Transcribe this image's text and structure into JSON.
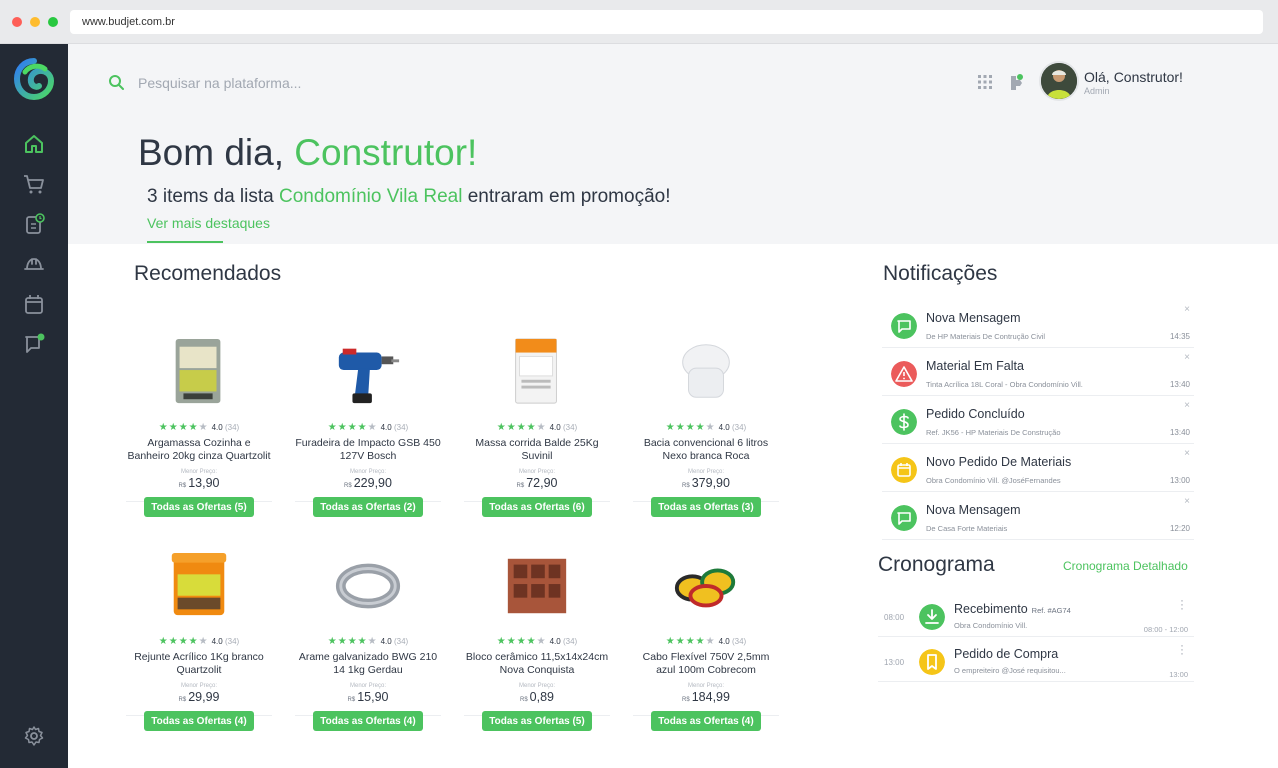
{
  "browser": {
    "url": "www.budjet.com.br"
  },
  "colors": {
    "accent": "#4cc35f",
    "sidebar": "#232a35",
    "warning": "#eb5b5b",
    "yellow": "#f5c518"
  },
  "sidebar": {
    "items": [
      {
        "icon": "home-icon"
      },
      {
        "icon": "cart-icon"
      },
      {
        "icon": "clipboard-clock-icon"
      },
      {
        "icon": "helmet-icon"
      },
      {
        "icon": "calendar-icon"
      },
      {
        "icon": "chat-icon"
      }
    ],
    "settings_icon": "gear-icon"
  },
  "header": {
    "search_placeholder": "Pesquisar na plataforma...",
    "greeting_prefix": "Olá,",
    "user_name": "Construtor!",
    "role": "Admin"
  },
  "hero": {
    "hello": "Bom dia,",
    "name": "Construtor!",
    "promo_prefix": "3 items da lista",
    "promo_list": "Condomínio Vila Real",
    "promo_suffix": "entraram em promoção!",
    "more_link": "Ver mais destaques"
  },
  "recommended": {
    "title": "Recomendados",
    "price_label": "Menor Preço:",
    "currency": "R$",
    "products": [
      {
        "name": "Argamassa Cozinha e Banheiro 20kg cinza Quartzolit",
        "rating": "4.0",
        "count": "(34)",
        "price": "13,90",
        "offers": "Todas as Ofertas (5)"
      },
      {
        "name": "Furadeira de Impacto GSB 450 127V Bosch",
        "rating": "4.0",
        "count": "(34)",
        "price": "229,90",
        "offers": "Todas as Ofertas (2)"
      },
      {
        "name": "Massa corrida Balde 25Kg Suvinil",
        "rating": "4.0",
        "count": "(34)",
        "price": "72,90",
        "offers": "Todas as Ofertas (6)"
      },
      {
        "name": "Bacia convencional 6 litros Nexo branca Roca",
        "rating": "4.0",
        "count": "(34)",
        "price": "379,90",
        "offers": "Todas as Ofertas (3)"
      },
      {
        "name": "Rejunte Acrílico 1Kg branco Quartzolit",
        "rating": "4.0",
        "count": "(34)",
        "price": "29,99",
        "offers": "Todas as Ofertas (4)"
      },
      {
        "name": "Arame galvanizado BWG 210 14 1kg Gerdau",
        "rating": "4.0",
        "count": "(34)",
        "price": "15,90",
        "offers": "Todas as Ofertas (4)"
      },
      {
        "name": "Bloco cerâmico 11,5x14x24cm Nova Conquista",
        "rating": "4.0",
        "count": "(34)",
        "price": "0,89",
        "offers": "Todas as Ofertas (5)"
      },
      {
        "name": "Cabo Flexível 750V 2,5mm azul 100m Cobrecom",
        "rating": "4.0",
        "count": "(34)",
        "price": "184,99",
        "offers": "Todas as Ofertas (4)"
      }
    ]
  },
  "notifications": {
    "title": "Notificações",
    "items": [
      {
        "title": "Nova Mensagem",
        "sub": "De HP Materiais De Contrução Civil",
        "time": "14:35",
        "icon": "message-icon"
      },
      {
        "title": "Material Em Falta",
        "sub": "Tinta Acrílica 18L Coral - Obra Condomínio Vill.",
        "time": "13:40",
        "icon": "warning-icon"
      },
      {
        "title": "Pedido Concluído",
        "sub": "Ref. JK56 - HP Materiais De Construção",
        "time": "13:40",
        "icon": "dollar-icon"
      },
      {
        "title": "Novo Pedido De Materiais",
        "sub": "Obra Condomínio Vill. @JoséFernandes",
        "time": "13:00",
        "icon": "calendar-icon"
      },
      {
        "title": "Nova Mensagem",
        "sub": "De Casa Forte Materiais",
        "time": "12:20",
        "icon": "message-icon"
      }
    ]
  },
  "cronograma": {
    "title": "Cronograma",
    "link": "Cronograma Detalhado",
    "items": [
      {
        "time": "08:00",
        "title": "Recebimento",
        "ref": "Ref. #AG74",
        "sub": "Obra Condomínio Vill.",
        "right": "08:00 - 12:00",
        "icon": "download-icon"
      },
      {
        "time": "13:00",
        "title": "Pedido de Compra",
        "ref": "",
        "sub": "O empreiteiro @José requisitou...",
        "right": "13:00",
        "icon": "bookmark-icon"
      }
    ]
  }
}
